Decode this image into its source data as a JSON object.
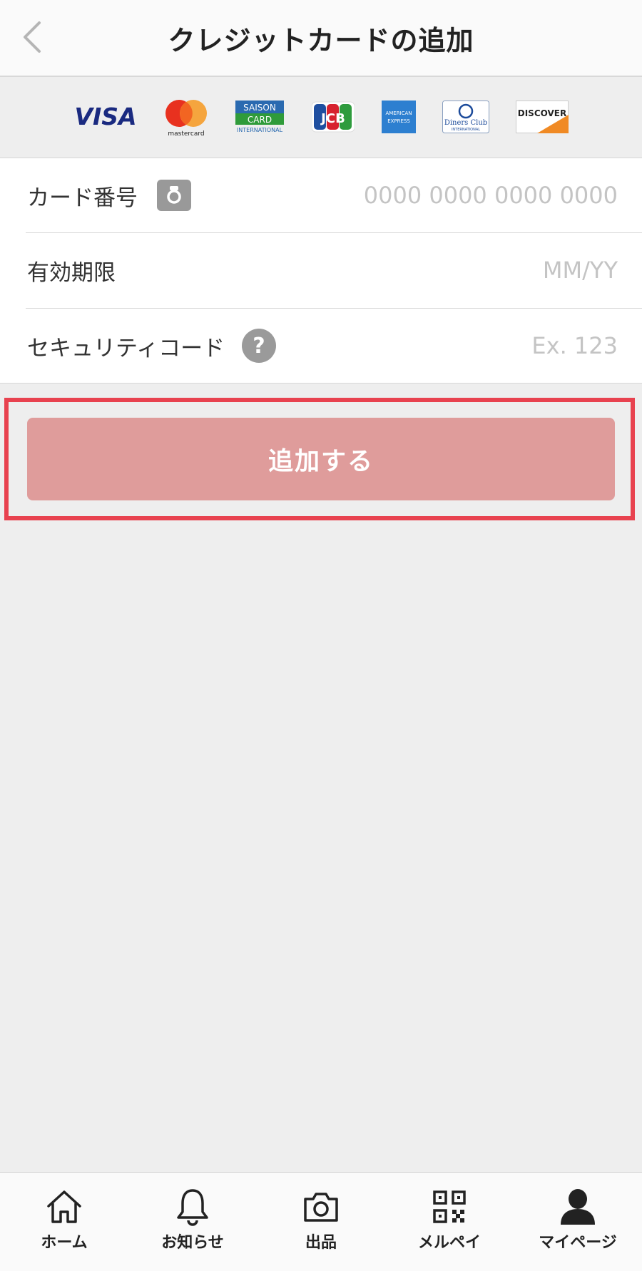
{
  "header": {
    "title": "クレジットカードの追加",
    "back_icon": "chevron-left-icon"
  },
  "brands": [
    {
      "name": "VISA",
      "icon": "visa-logo"
    },
    {
      "name": "mastercard",
      "icon": "mastercard-logo"
    },
    {
      "name": "SAISON CARD INTERNATIONAL",
      "icon": "saison-logo"
    },
    {
      "name": "JCB",
      "icon": "jcb-logo"
    },
    {
      "name": "AMERICAN EXPRESS",
      "icon": "amex-logo"
    },
    {
      "name": "Diners Club INTERNATIONAL",
      "icon": "diners-logo"
    },
    {
      "name": "DISCOVER",
      "icon": "discover-logo"
    }
  ],
  "form": {
    "card_number": {
      "label": "カード番号",
      "placeholder": "0000 0000 0000 0000",
      "value": ""
    },
    "expiry": {
      "label": "有効期限",
      "placeholder": "MM/YY",
      "value": ""
    },
    "security_code": {
      "label": "セキュリティコード",
      "placeholder": "Ex. 123",
      "value": "",
      "help_glyph": "?"
    }
  },
  "submit": {
    "label": "追加する",
    "color": "#df9c9b"
  },
  "highlight_color": "#e8424f",
  "tabbar": {
    "items": [
      {
        "label": "ホーム",
        "icon": "home-icon"
      },
      {
        "label": "お知らせ",
        "icon": "bell-icon"
      },
      {
        "label": "出品",
        "icon": "camera-icon"
      },
      {
        "label": "メルペイ",
        "icon": "qr-code-icon"
      },
      {
        "label": "マイページ",
        "icon": "person-icon"
      }
    ]
  }
}
